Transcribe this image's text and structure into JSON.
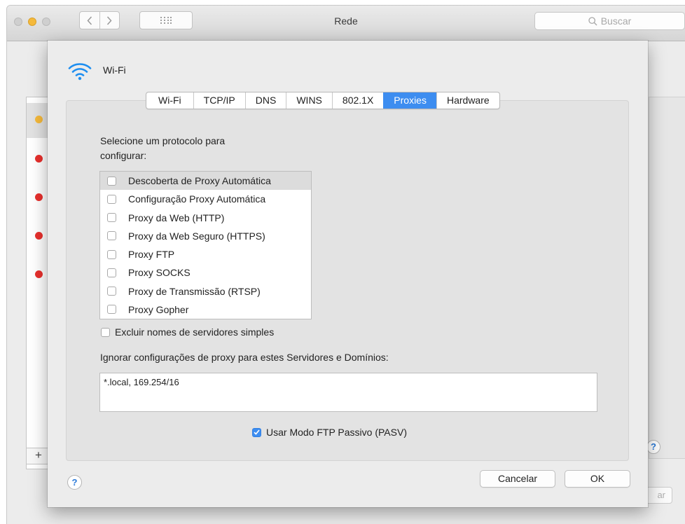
{
  "window": {
    "title": "Rede",
    "search_placeholder": "Buscar"
  },
  "background": {
    "plus_label": "+",
    "help_label": "?",
    "partial_button": "ar"
  },
  "sheet": {
    "title": "Wi-Fi",
    "tabs": [
      {
        "label": "Wi-Fi",
        "active": false
      },
      {
        "label": "TCP/IP",
        "active": false
      },
      {
        "label": "DNS",
        "active": false
      },
      {
        "label": "WINS",
        "active": false
      },
      {
        "label": "802.1X",
        "active": false
      },
      {
        "label": "Proxies",
        "active": true
      },
      {
        "label": "Hardware",
        "active": false
      }
    ],
    "protocol_label_line1": "Selecione um protocolo para",
    "protocol_label_line2": "configurar:",
    "protocols": [
      {
        "label": "Descoberta de Proxy Automática",
        "checked": false,
        "selected": true
      },
      {
        "label": "Configuração Proxy Automática",
        "checked": false,
        "selected": false
      },
      {
        "label": "Proxy da Web (HTTP)",
        "checked": false,
        "selected": false
      },
      {
        "label": "Proxy da Web Seguro (HTTPS)",
        "checked": false,
        "selected": false
      },
      {
        "label": "Proxy FTP",
        "checked": false,
        "selected": false
      },
      {
        "label": "Proxy SOCKS",
        "checked": false,
        "selected": false
      },
      {
        "label": "Proxy de Transmissão (RTSP)",
        "checked": false,
        "selected": false
      },
      {
        "label": "Proxy Gopher",
        "checked": false,
        "selected": false
      }
    ],
    "exclude_simple_hosts": {
      "label": "Excluir nomes de servidores simples",
      "checked": false
    },
    "bypass_label": "Ignorar configurações de proxy para estes Servidores e Domínios:",
    "bypass_value": "*.local, 169.254/16",
    "passive_ftp": {
      "label": "Usar Modo FTP Passivo (PASV)",
      "checked": true
    },
    "help_label": "?",
    "cancel_label": "Cancelar",
    "ok_label": "OK"
  },
  "colors": {
    "accent": "#3d8df0",
    "status_orange": "#f5b93b",
    "status_red": "#e8302d"
  }
}
